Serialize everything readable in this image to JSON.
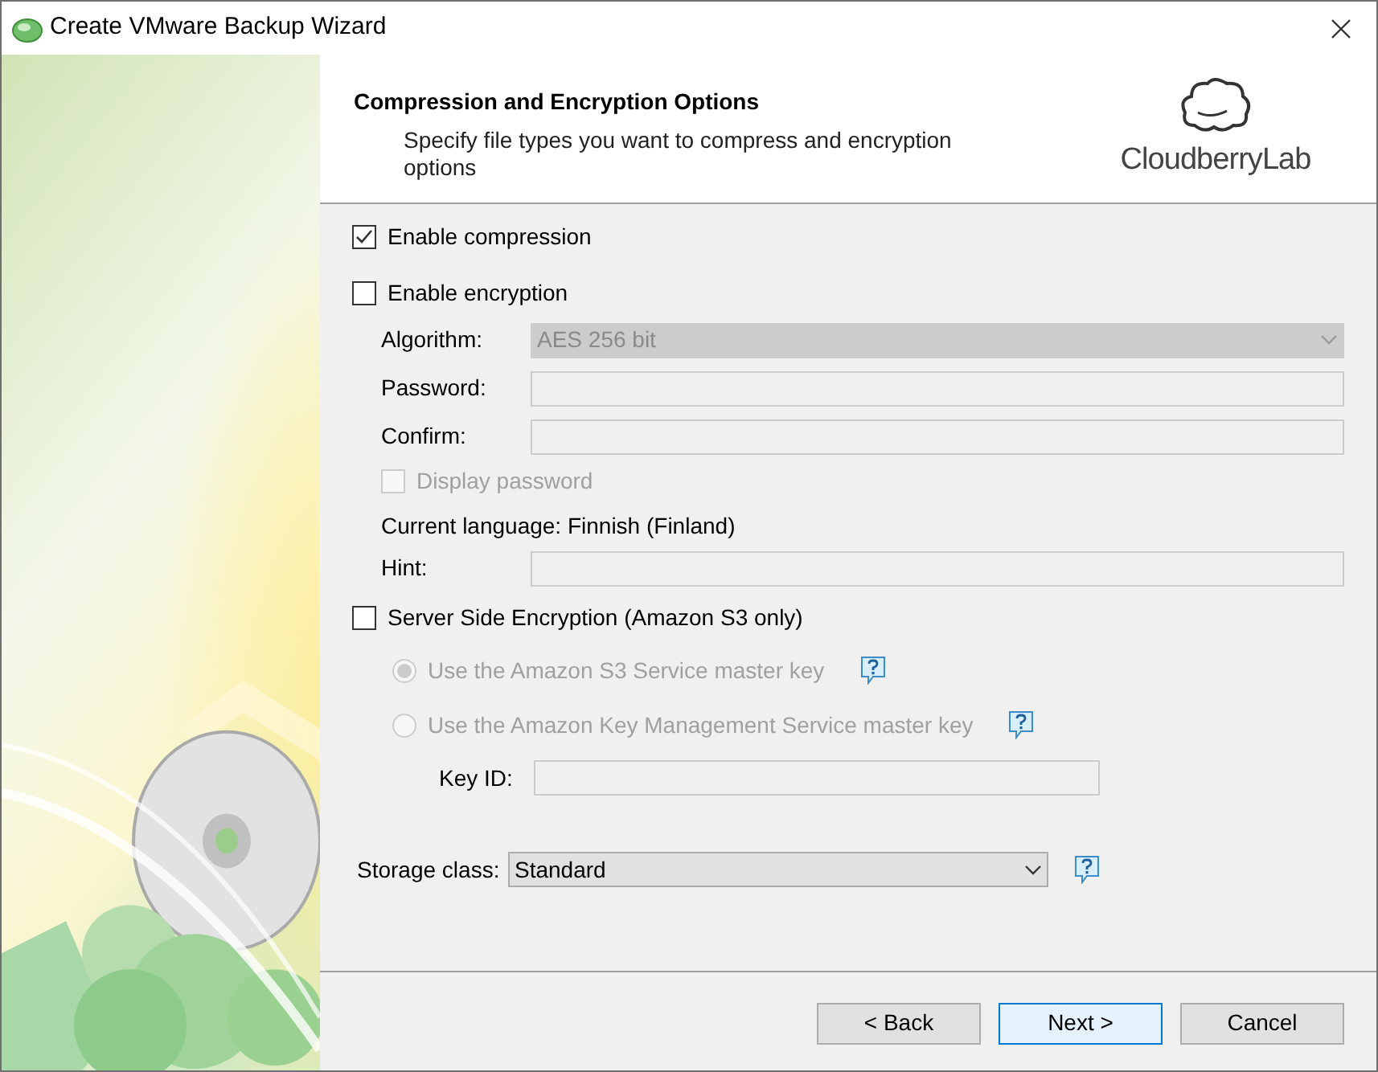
{
  "window": {
    "title": "Create VMware Backup Wizard"
  },
  "header": {
    "title": "Compression and Encryption Options",
    "subtitle": "Specify file types you want to compress and encryption options",
    "logo_text": "CloudberryLab"
  },
  "compression": {
    "label": "Enable compression",
    "checked": true
  },
  "encryption": {
    "label": "Enable encryption",
    "checked": false,
    "fields": [
      {
        "kind": "select",
        "label": "Algorithm:",
        "value": "AES 256 bit",
        "disabled": true
      },
      {
        "kind": "text",
        "label": "Password:",
        "disabled": true
      },
      {
        "kind": "text",
        "label": "Confirm:",
        "disabled": true
      }
    ],
    "display_password": {
      "label": "Display password",
      "checked": false,
      "disabled": true
    },
    "current_language": "Current language: Finnish (Finland)",
    "hint": {
      "label": "Hint:",
      "disabled": true
    }
  },
  "server_side_encryption": {
    "label": "Server Side Encryption (Amazon S3 only)",
    "checked": false,
    "options": [
      {
        "label": "Use the Amazon S3 Service master key",
        "selected": true,
        "disabled": true
      },
      {
        "label": "Use the Amazon Key Management Service master key",
        "selected": false,
        "disabled": true
      }
    ],
    "key_id": {
      "label": "Key ID:",
      "disabled": true
    }
  },
  "storage_class": {
    "label": "Storage class:",
    "value": "Standard"
  },
  "buttons": [
    {
      "label": "< Back",
      "default": false
    },
    {
      "label": "Next >",
      "default": true
    },
    {
      "label": "Cancel",
      "default": false
    }
  ]
}
